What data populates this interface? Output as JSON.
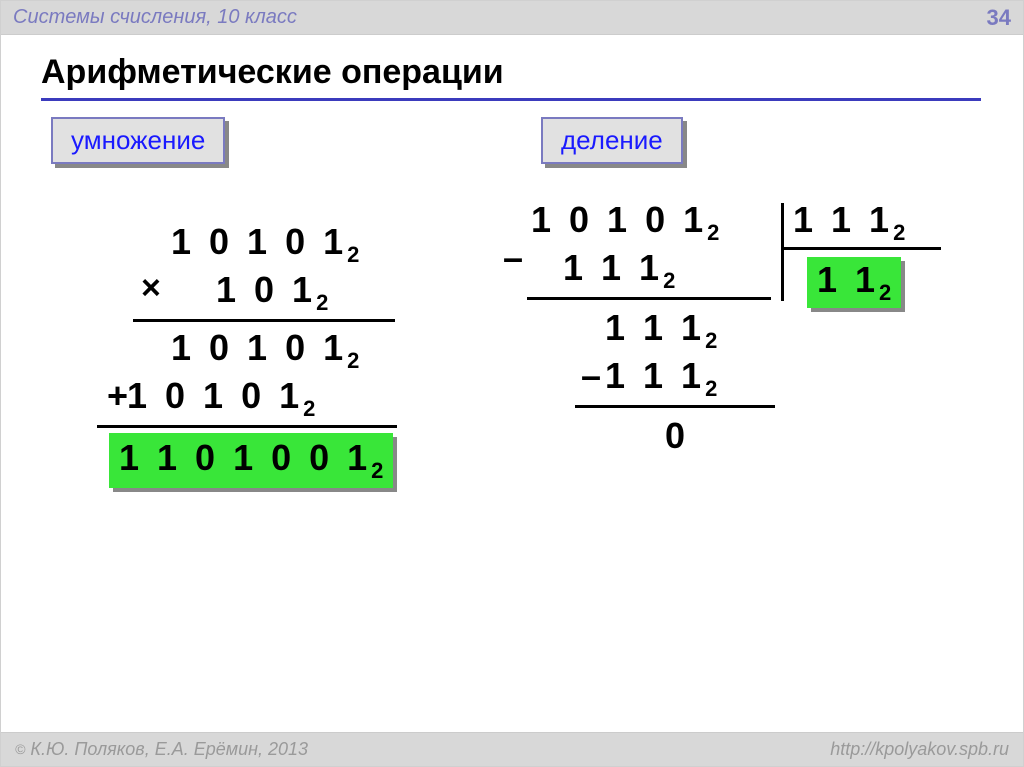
{
  "header": {
    "title": "Системы счисления, 10 класс",
    "page": "34"
  },
  "title": "Арифметические операции",
  "labels": {
    "multiplication": "умножение",
    "division": "деление"
  },
  "multiplication": {
    "operand1": "1 0 1 0 1",
    "operand1_base": "2",
    "operator": "×",
    "operand2": "1 0 1",
    "operand2_base": "2",
    "partial1": "1 0 1 0 1",
    "partial1_base": "2",
    "plus": "+",
    "partial2": "1 0 1 0 1",
    "partial2_base": "2",
    "result": "1 1 0 1 0 0 1",
    "result_base": "2"
  },
  "division": {
    "dividend": "1 0 1 0 1",
    "dividend_base": "2",
    "divisor": "1 1 1",
    "divisor_base": "2",
    "quotient": "1 1",
    "quotient_base": "2",
    "minus": "–",
    "sub1": "1 1 1",
    "sub1_base": "2",
    "rem1": "1 1 1",
    "rem1_base": "2",
    "minus2_prefix": "–",
    "sub2": "1 1 1",
    "sub2_base": "2",
    "rem2": "0"
  },
  "footer": {
    "copyright": "К.Ю. Поляков, Е.А. Ерёмин, 2013",
    "url": "http://kpolyakov.spb.ru"
  }
}
